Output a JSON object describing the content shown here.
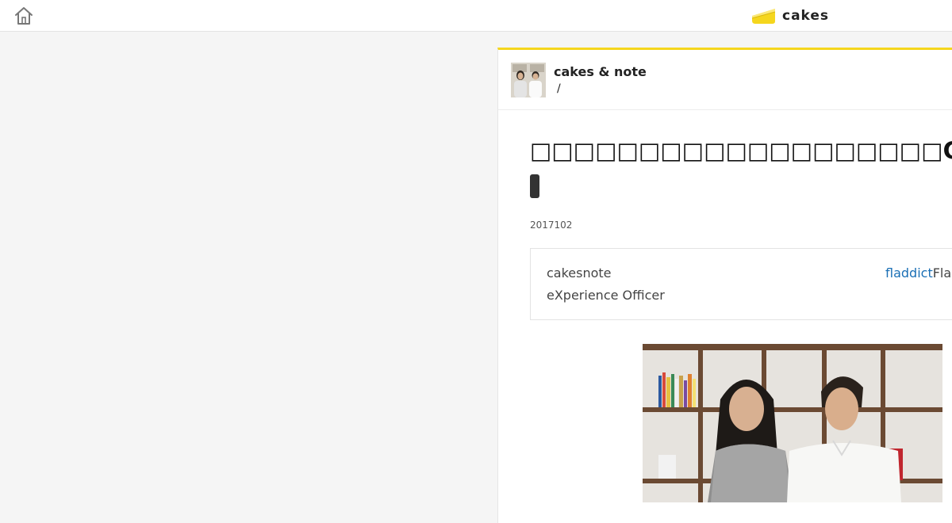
{
  "header": {
    "home_icon": "home-icon",
    "logo_text": "cakes",
    "logo_color": "#f5d61d"
  },
  "article": {
    "accent_color": "#f5d61d",
    "author": {
      "name": "cakes & note",
      "sub": "/"
    },
    "title": "□□□□□□□□□□□□□□□□□□□CXO□□□□□□□",
    "date": "2017102",
    "summary": {
      "line1": "cakesnote",
      "line2": "eXperience Officer",
      "link": "fladdict",
      "link_rest": "Fla"
    }
  }
}
